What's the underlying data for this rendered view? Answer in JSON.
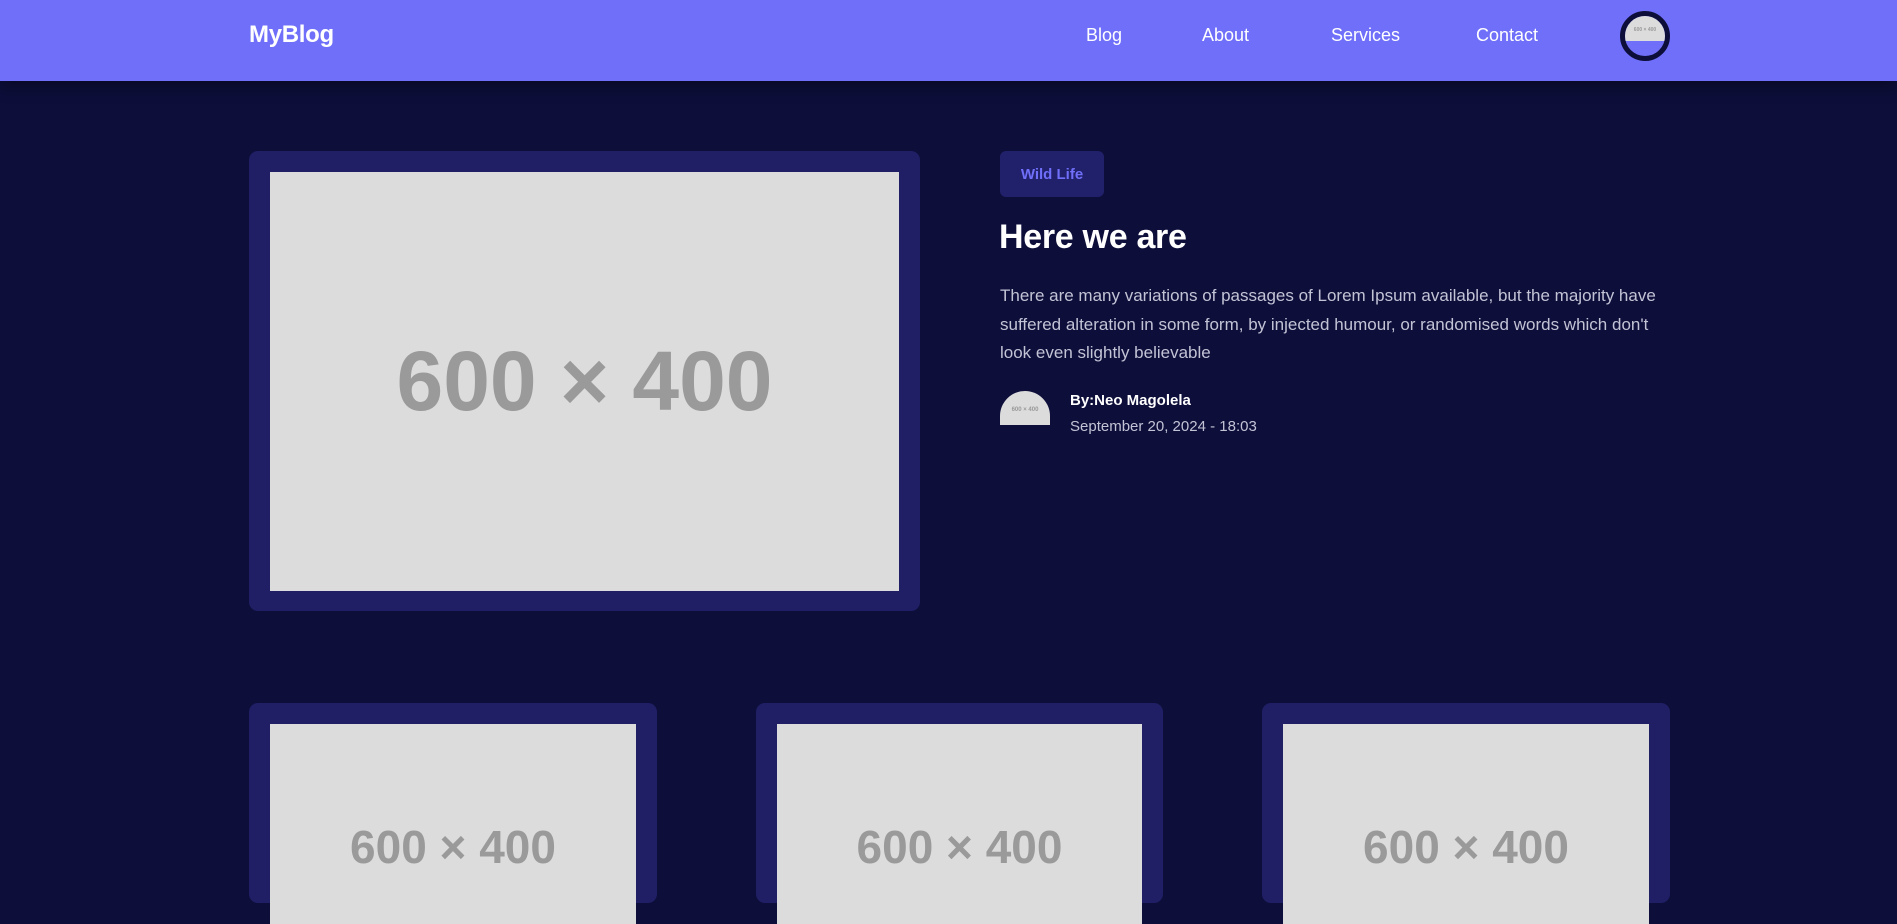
{
  "nav": {
    "logo": "MyBlog",
    "links": [
      "Blog",
      "About",
      "Services",
      "Contact"
    ],
    "avatar_placeholder": "600 × 400"
  },
  "featured": {
    "image_placeholder": "600 × 400",
    "tag": "Wild Life",
    "title": "Here we are",
    "excerpt": "There are many variations of passages of Lorem Ipsum available, but the majority have suffered alteration in some form, by injected humour, or randomised words which don't look even slightly believable",
    "author_avatar_placeholder": "600 × 400",
    "author": "By:Neo Magolela",
    "date": "September 20, 2024 - 18:03"
  },
  "posts": [
    {
      "image_placeholder": "600 × 400"
    },
    {
      "image_placeholder": "600 × 400"
    },
    {
      "image_placeholder": "600 × 400"
    }
  ],
  "colors": {
    "background": "#0d0e3a",
    "navbar": "#6f6ff9",
    "card": "#201f66",
    "accent": "#6f6ff9",
    "placeholder": "#dcdcdc"
  }
}
